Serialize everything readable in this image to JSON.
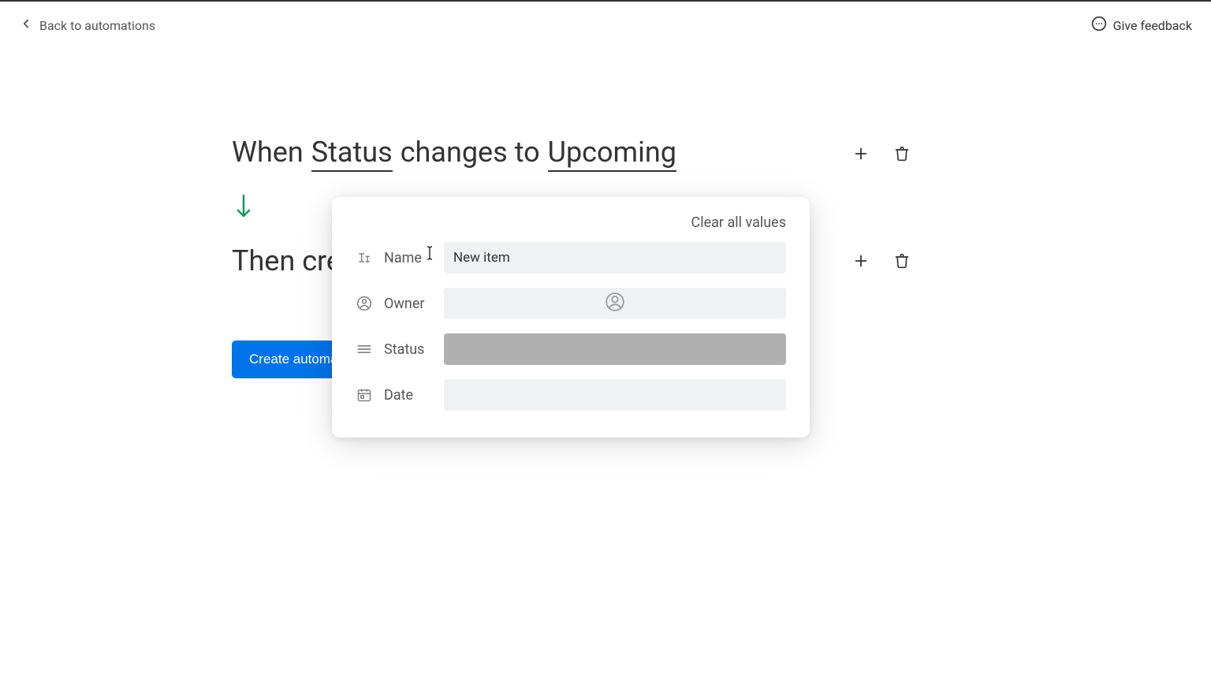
{
  "header": {
    "back_label": "Back to automations",
    "feedback_label": "Give feedback"
  },
  "trigger": {
    "when": "When",
    "field": "Status",
    "verb": "changes to",
    "value": "Upcoming"
  },
  "action": {
    "then_text": "Then cre"
  },
  "create_button": "Create automa",
  "popup": {
    "clear_label": "Clear all values",
    "fields": {
      "name": {
        "label": "Name",
        "value": "New item"
      },
      "owner": {
        "label": "Owner"
      },
      "status": {
        "label": "Status"
      },
      "date": {
        "label": "Date"
      }
    }
  }
}
